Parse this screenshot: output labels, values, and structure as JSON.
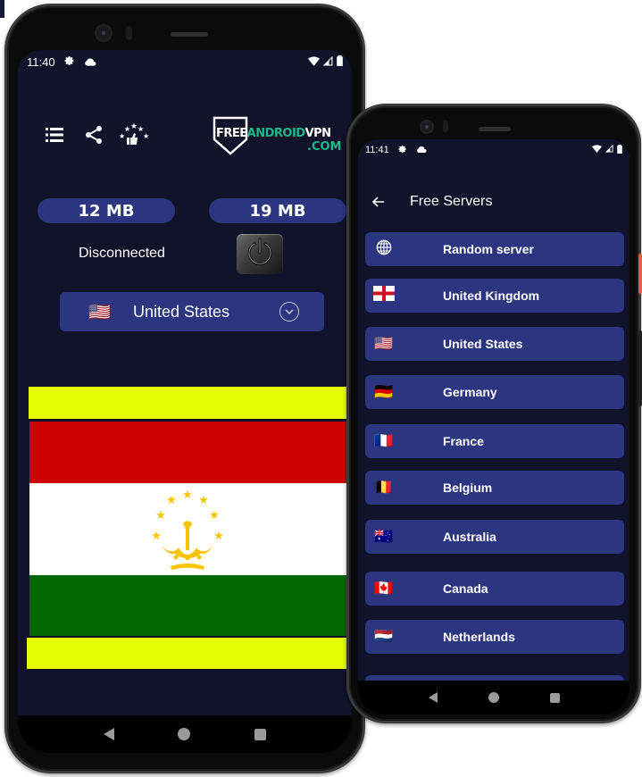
{
  "left_phone": {
    "status_bar": {
      "time": "11:40",
      "left_icons": [
        "gear-icon",
        "cloud-icon"
      ],
      "right_icons": [
        "wifi-icon",
        "signal-icon",
        "battery-icon"
      ]
    },
    "toolbar": {
      "icons": [
        "server-list-icon",
        "share-icon",
        "rate-icon"
      ]
    },
    "logo": {
      "free": "FREE",
      "android": "ANDROID",
      "vpn": "VPN",
      "com": ".COM",
      "colors": {
        "white": "#ffffff",
        "green": "#22b58a"
      }
    },
    "traffic": {
      "download": "12 MB",
      "upload": "19 MB"
    },
    "connection_status": "Disconnected",
    "selected_country": {
      "flag": "🇺🇸",
      "name": "United States"
    },
    "flag_display": {
      "country": "Tajikistan",
      "colors": {
        "yellow": "#e3ff00",
        "red": "#cc0000",
        "white": "#ffffff",
        "green": "#006600",
        "emblem": "#f8c300"
      }
    }
  },
  "right_phone": {
    "status_bar": {
      "time": "11:41",
      "left_icons": [
        "gear-icon",
        "cloud-icon"
      ],
      "right_icons": [
        "wifi-icon",
        "signal-icon",
        "battery-icon"
      ]
    },
    "appbar": {
      "title": "Free Servers"
    },
    "servers": [
      {
        "flag": "globe",
        "name": "Random server"
      },
      {
        "flag": "🏴󠁧󠁢󠁥󠁮󠁧󠁿",
        "name": "United Kingdom"
      },
      {
        "flag": "🇺🇸",
        "name": "United States"
      },
      {
        "flag": "🇩🇪",
        "name": "Germany"
      },
      {
        "flag": "🇫🇷",
        "name": "France"
      },
      {
        "flag": "🇧🇪",
        "name": "Belgium"
      },
      {
        "flag": "🇦🇺",
        "name": "Australia"
      },
      {
        "flag": "🇨🇦",
        "name": "Canada"
      },
      {
        "flag": "🇳🇱",
        "name": "Netherlands"
      }
    ]
  },
  "theme": {
    "screen_bg": "#10132a",
    "accent": "#2b3580"
  }
}
